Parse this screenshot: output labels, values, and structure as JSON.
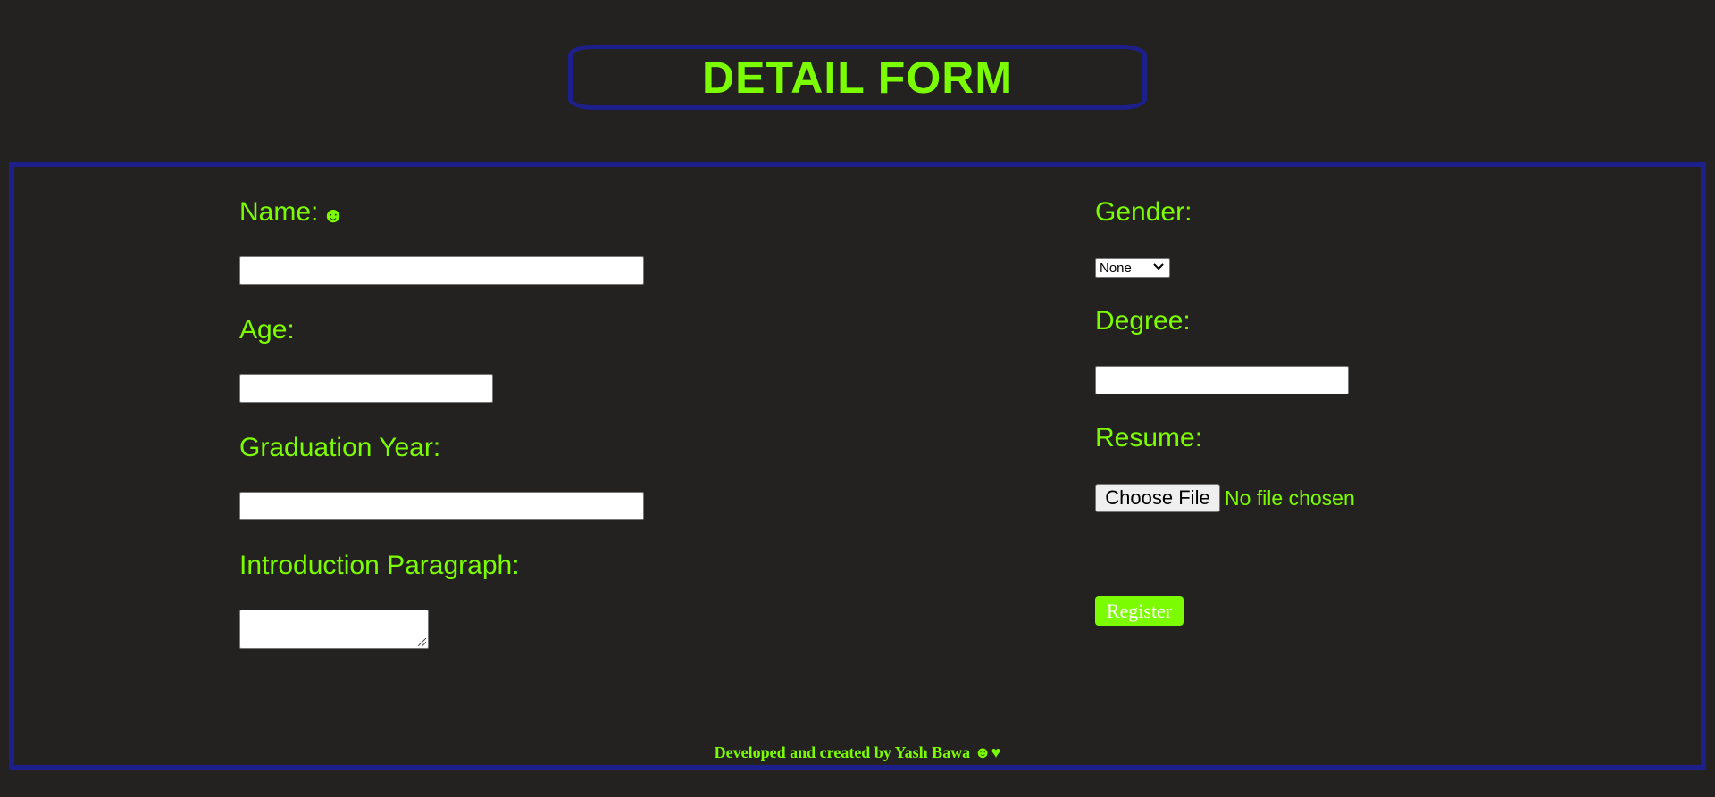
{
  "header": {
    "title": "DETAIL FORM"
  },
  "form": {
    "name": {
      "label": "Name:",
      "icon": "☻",
      "value": ""
    },
    "age": {
      "label": "Age:",
      "value": ""
    },
    "graduation_year": {
      "label": "Graduation Year:",
      "value": ""
    },
    "introduction": {
      "label": "Introduction Paragraph:",
      "value": ""
    },
    "gender": {
      "label": "Gender:",
      "selected": "None"
    },
    "degree": {
      "label": "Degree:",
      "value": ""
    },
    "resume": {
      "label": "Resume:",
      "button_label": "Choose File",
      "status": "No file chosen"
    },
    "register_label": "Register"
  },
  "footer": {
    "text": "Developed and created by Yash Bawa ☻♥"
  },
  "colors": {
    "background": "#232221",
    "accent": "#7cfc00",
    "border": "#1d1f8a"
  }
}
